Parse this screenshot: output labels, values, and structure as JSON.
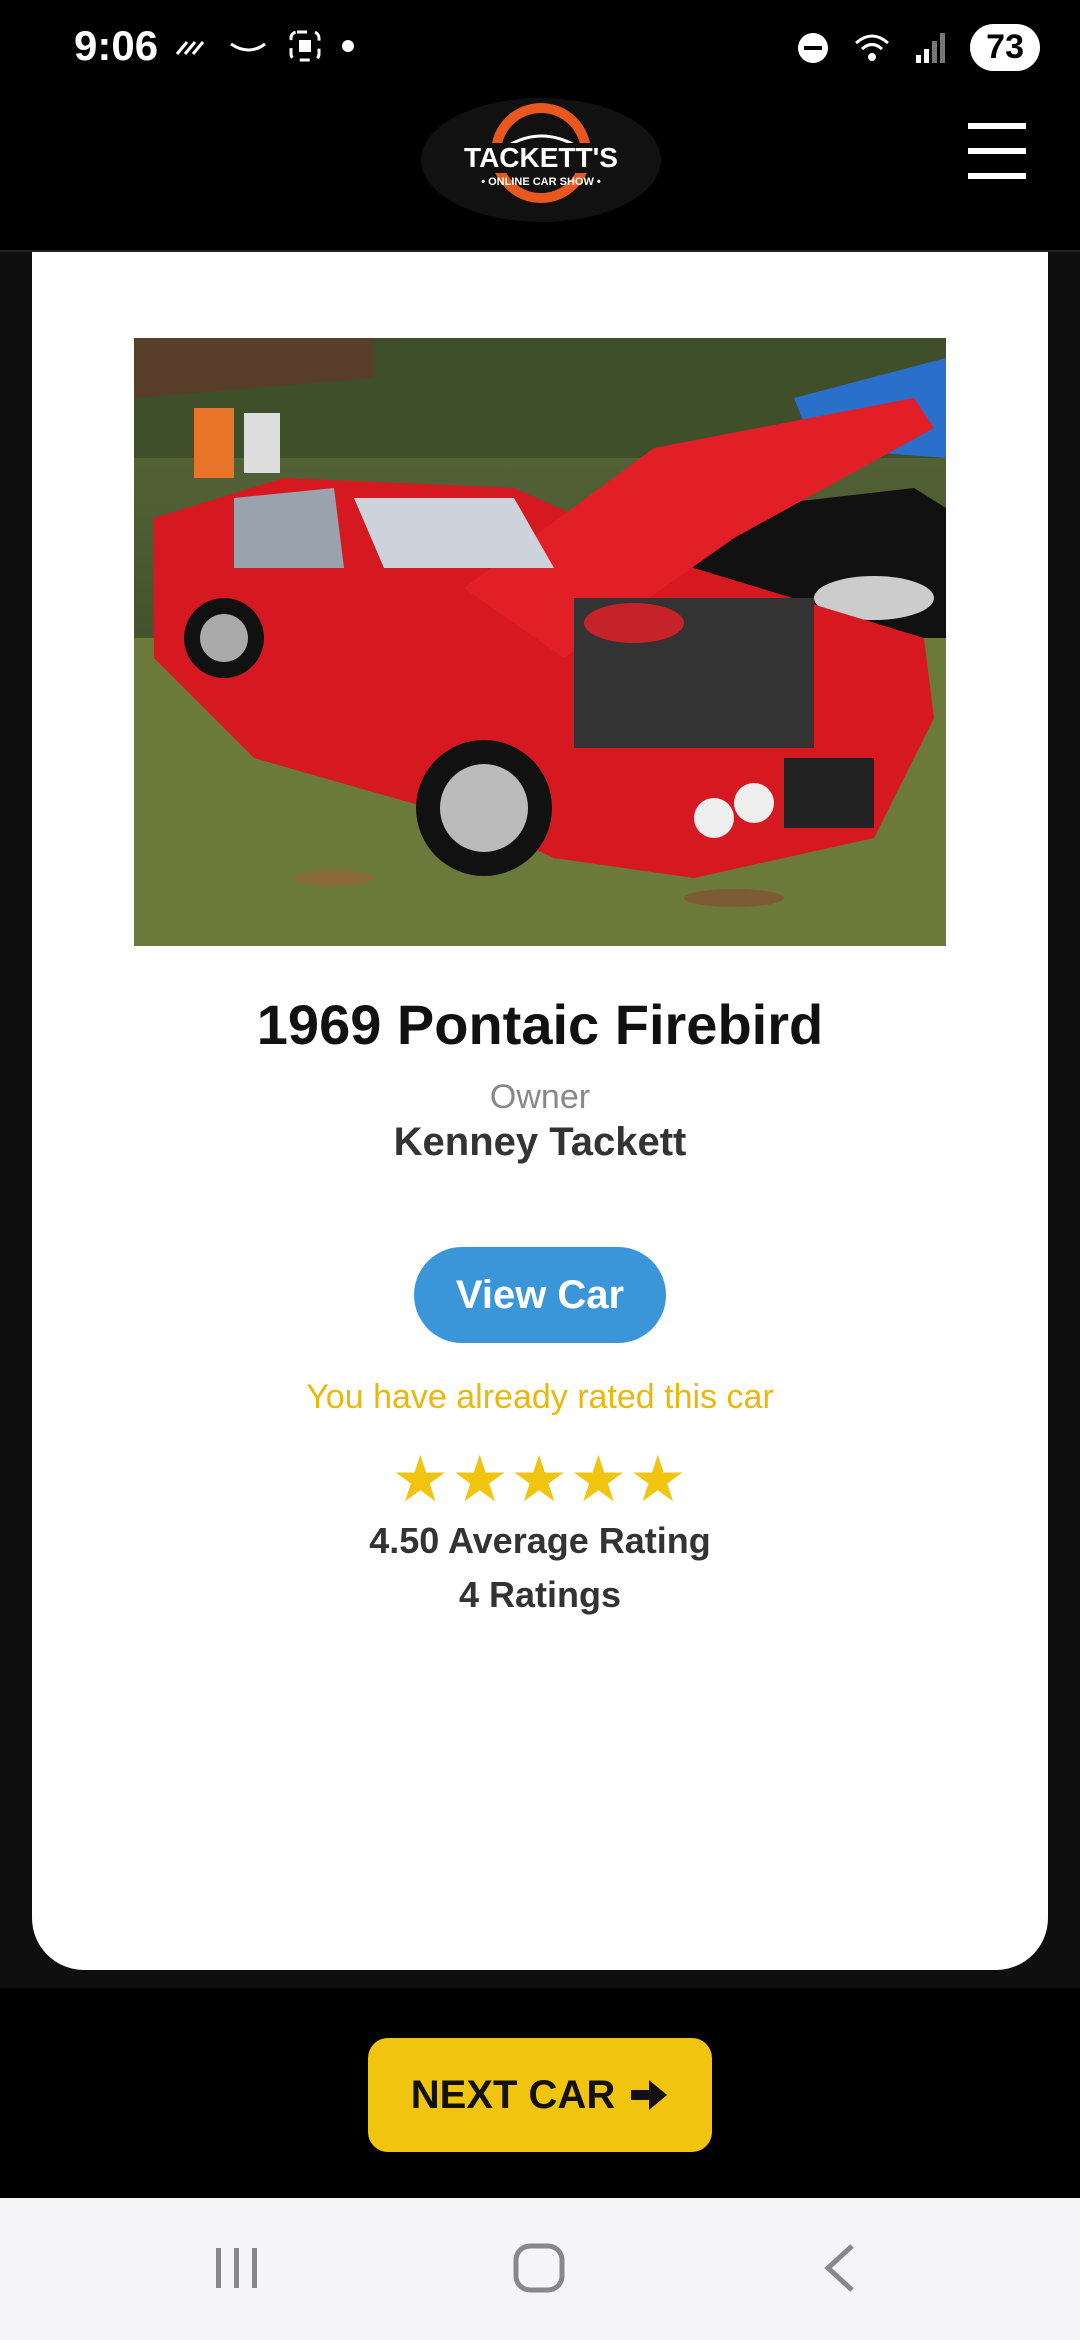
{
  "status_bar": {
    "time": "9:06",
    "battery": "73"
  },
  "header": {
    "logo_text_1": "TACKETT'S",
    "logo_text_2": "ONLINE CAR SHOW"
  },
  "car": {
    "title": "1969 Pontaic Firebird",
    "owner_label": "Owner",
    "owner_name": "Kenney Tackett",
    "view_button": "View Car",
    "rated_message": "You have already rated this car",
    "stars": "★★★★★",
    "average_rating": "4.50 Average Rating",
    "ratings_count": "4 Ratings"
  },
  "next_button": {
    "label": "NEXT CAR",
    "icon": "arrow-right-icon"
  },
  "colors": {
    "accent_yellow": "#f1c40f",
    "button_blue": "#3a96d8"
  }
}
